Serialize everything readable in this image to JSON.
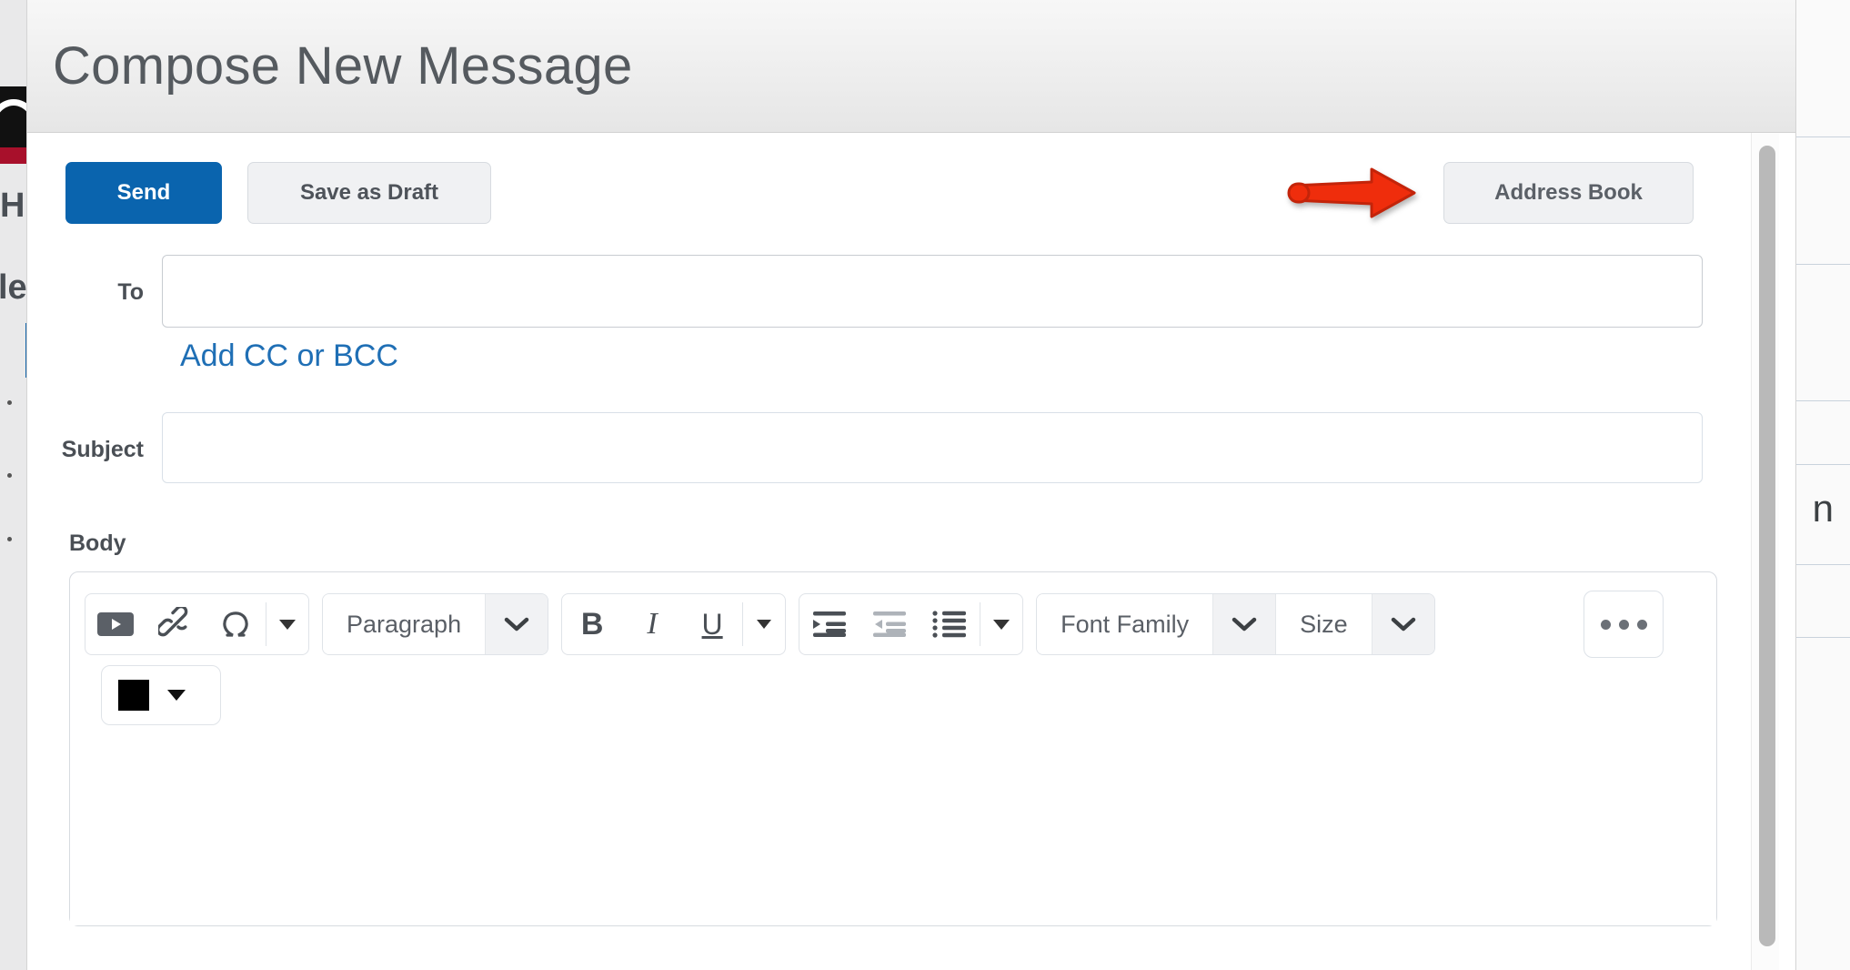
{
  "window": {
    "title": "Compose New Message"
  },
  "actions": {
    "send_label": "Send",
    "draft_label": "Save as Draft",
    "address_book_label": "Address Book"
  },
  "annotation": {
    "type": "arrow",
    "direction": "right",
    "color": "#ef2d0c",
    "points_to": "address-book-button"
  },
  "fields": {
    "to": {
      "label": "To",
      "value": "",
      "placeholder": ""
    },
    "cc_bcc_link": "Add CC or BCC",
    "subject": {
      "label": "Subject",
      "value": "",
      "placeholder": ""
    },
    "body": {
      "label": "Body",
      "value": "",
      "placeholder": ""
    }
  },
  "editor": {
    "groups": [
      {
        "name": "insert",
        "buttons": [
          {
            "icon": "media-play-icon",
            "label": "Insert Stuff"
          },
          {
            "icon": "link-icon",
            "label": "Quicklink"
          },
          {
            "icon": "omega-icon",
            "label": "Insert Special Character"
          }
        ],
        "overflow_caret": true
      },
      {
        "name": "format-style",
        "select": {
          "value": "Paragraph",
          "caret": "chevron-down-icon"
        }
      },
      {
        "name": "text-style",
        "buttons": [
          {
            "icon": "bold-icon",
            "label": "B"
          },
          {
            "icon": "italic-icon",
            "label": "I"
          },
          {
            "icon": "underline-icon",
            "label": "U"
          }
        ],
        "overflow_caret": true
      },
      {
        "name": "lists-indent",
        "buttons": [
          {
            "icon": "indent-increase-icon",
            "label": "Indent",
            "state": "enabled"
          },
          {
            "icon": "indent-decrease-icon",
            "label": "Outdent",
            "state": "disabled"
          },
          {
            "icon": "bullet-list-icon",
            "label": "Unordered List",
            "state": "enabled"
          }
        ],
        "overflow_caret": true
      },
      {
        "name": "font",
        "selects": [
          {
            "value": "Font Family",
            "caret": "chevron-down-icon"
          },
          {
            "value": "Size",
            "caret": "chevron-down-icon"
          }
        ]
      },
      {
        "name": "overflow",
        "buttons": [
          {
            "icon": "ellipsis-icon",
            "label": "More Actions"
          }
        ]
      },
      {
        "name": "color",
        "swatch_color": "#000000",
        "caret": "caret-down-icon"
      }
    ]
  },
  "background_page": {
    "left_fragments": [
      "H",
      "le"
    ],
    "right_fragment": "n"
  },
  "colors": {
    "accent_blue": "#0a64ae",
    "link_blue": "#1f6fb5",
    "annotation_red": "#ef2d0c",
    "header_gray": "#eeeeee",
    "text_dark": "#4a4f55",
    "button_gray": "#f0f1f3",
    "border_gray": "#d7dbe0"
  },
  "scrollbar": {
    "orientation": "vertical",
    "position": "right"
  }
}
